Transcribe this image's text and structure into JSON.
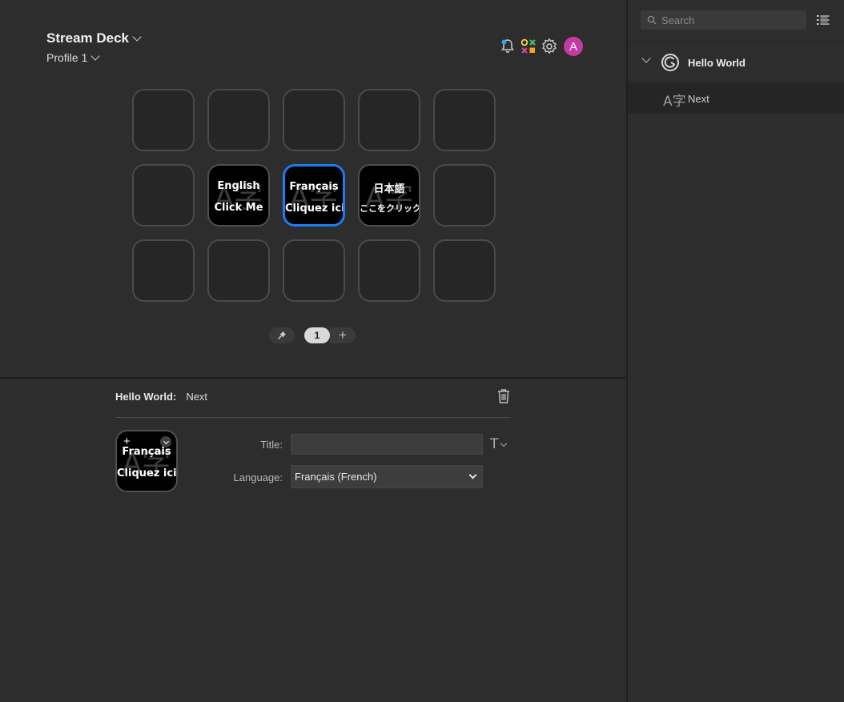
{
  "header": {
    "device": "Stream Deck",
    "profile": "Profile 1",
    "avatar_letter": "A"
  },
  "colors": {
    "selection": "#1b7cf5",
    "avatar": "#c43aa3"
  },
  "keys": {
    "english": {
      "line1": "English",
      "line2": "Click Me",
      "ghost": "A字"
    },
    "french": {
      "line1": "Français",
      "line2": "Cliquez ici",
      "ghost": "A字"
    },
    "japanese": {
      "line1": "日本語",
      "line2": "ここをクリック",
      "ghost": "A字"
    }
  },
  "pager": {
    "current_page": "1"
  },
  "inspector": {
    "plugin": "Hello World:",
    "action": "Next",
    "title_label": "Title:",
    "title_value": "",
    "title_style_glyph": "T",
    "language_label": "Language:",
    "language_value": "Français (French)",
    "preview": {
      "line1": "Français",
      "line2": "Cliquez ici",
      "ghost": "A字"
    }
  },
  "sidebar": {
    "search_placeholder": "Search",
    "category": {
      "name": "Hello World",
      "expanded": true
    },
    "actions": [
      {
        "name": "Next",
        "icon": "A字"
      }
    ]
  }
}
